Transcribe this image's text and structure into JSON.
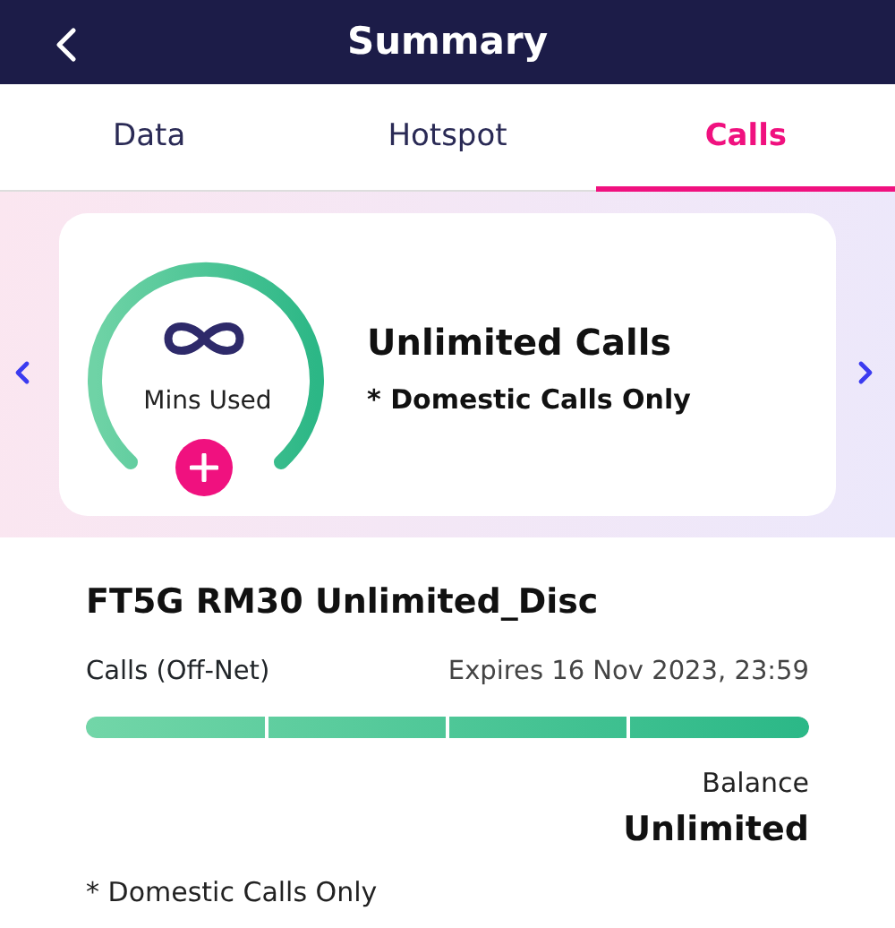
{
  "header": {
    "title": "Summary"
  },
  "tabs": [
    {
      "label": "Data",
      "selected": false
    },
    {
      "label": "Hotspot",
      "selected": false
    },
    {
      "label": "Calls",
      "selected": true
    }
  ],
  "summary_card": {
    "gauge_label": "Mins Used",
    "title": "Unlimited Calls",
    "note": "* Domestic Calls Only"
  },
  "plan": {
    "name": "FT5G RM30 Unlimited_Disc",
    "type": "Calls (Off-Net)",
    "expiry": "Expires 16 Nov 2023, 23:59",
    "level": 1,
    "balance_label": "Balance",
    "balance": "Unlimited",
    "note": "* Domestic Calls Only"
  }
}
